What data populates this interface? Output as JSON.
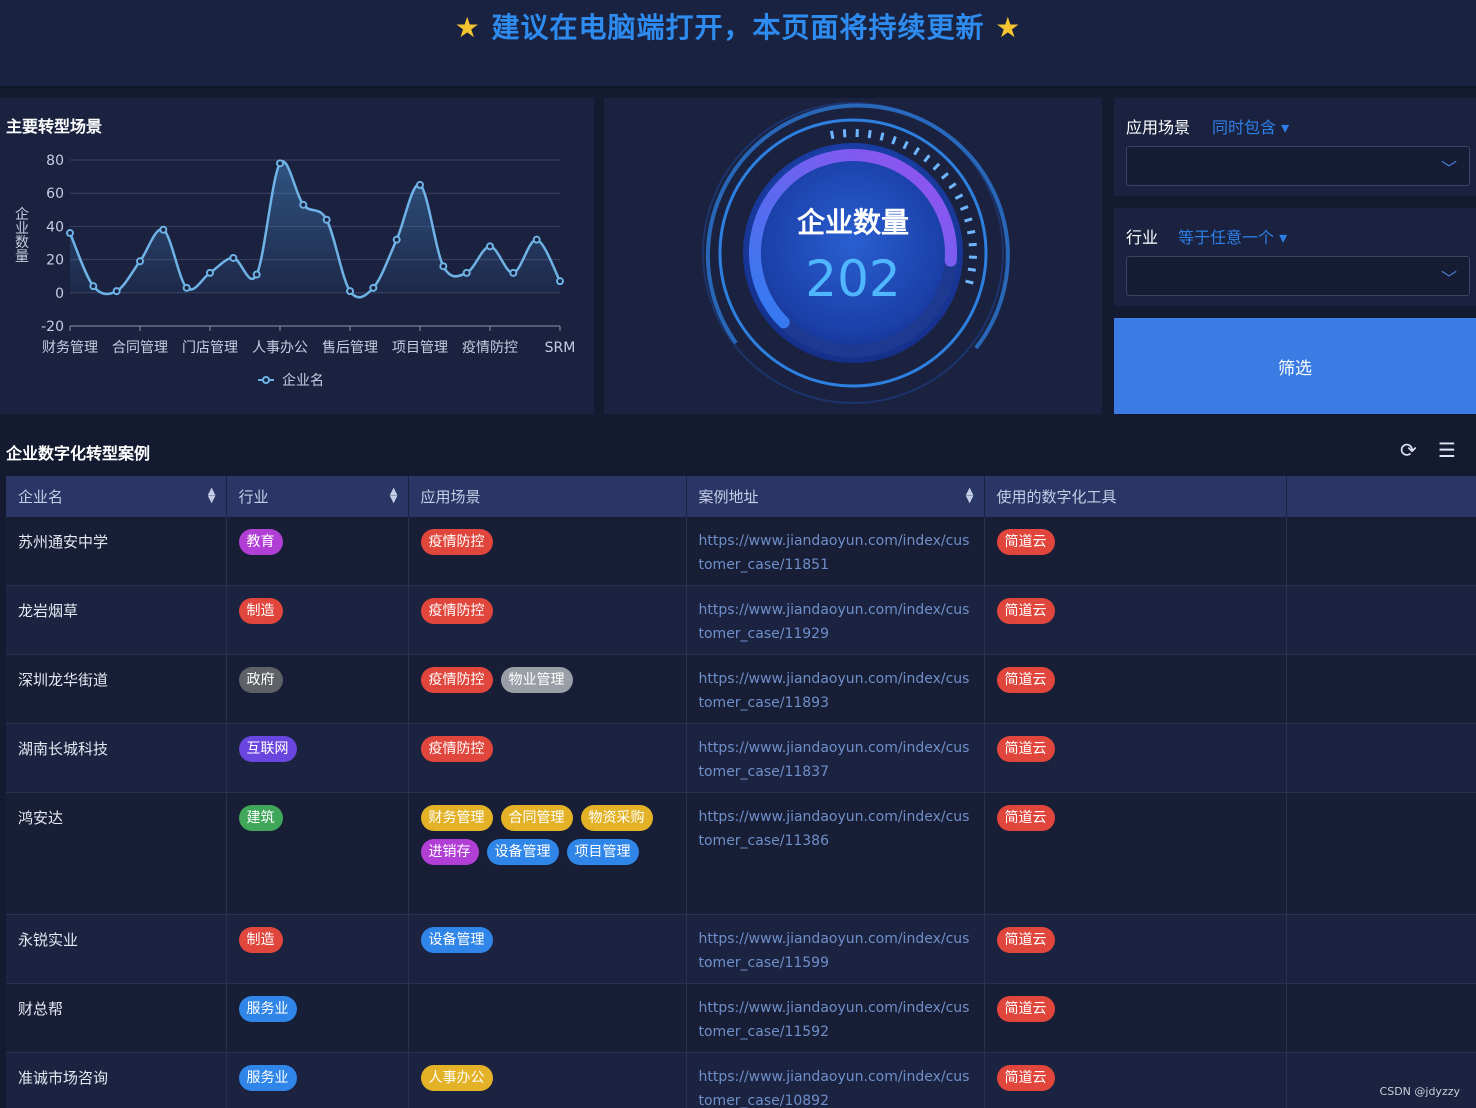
{
  "banner": {
    "star": "★",
    "text": "建议在电脑端打开，本页面将持续更新"
  },
  "chart_panel": {
    "title": "主要转型场景"
  },
  "chart_data": {
    "type": "line",
    "title": "主要转型场景",
    "ylabel": "企业数量",
    "xlabel": "",
    "ylim": [
      -20,
      80
    ],
    "yticks": [
      80,
      60,
      40,
      20,
      0,
      -20
    ],
    "tick_labels": [
      "财务管理",
      "合同管理",
      "门店管理",
      "人事办公",
      "售后管理",
      "项目管理",
      "疫情防控",
      "SRM"
    ],
    "grid": true,
    "legend_position": "bottom",
    "series": [
      {
        "name": "企业名",
        "color": "#6fb3e6",
        "values": [
          36,
          4,
          1,
          19,
          38,
          3,
          12,
          21,
          11,
          78,
          53,
          44,
          1,
          3,
          32,
          65,
          16,
          12,
          28,
          12,
          32,
          7
        ]
      }
    ]
  },
  "gauge": {
    "title": "企业数量",
    "value": "202",
    "fill_fraction": 0.85
  },
  "filters": [
    {
      "label": "应用场景",
      "mode": "同时包含",
      "value": ""
    },
    {
      "label": "行业",
      "mode": "等于任意一个",
      "value": ""
    }
  ],
  "filter_button": "筛选",
  "table": {
    "title": "企业数字化转型案例",
    "columns": [
      "企业名",
      "行业",
      "应用场景",
      "案例地址",
      "使用的数字化工具",
      ""
    ],
    "tag_colors": {
      "教育": "#b13fd6",
      "制造": "#e0463c",
      "政府": "#5e6166",
      "互联网": "#6a46e0",
      "建筑": "#3fa65a",
      "服务业": "#2f86e8",
      "疫情防控": "#e0463c",
      "物业管理": "#9a9ea6",
      "财务管理": "#e3b227",
      "合同管理": "#e3b227",
      "物资采购": "#e3b227",
      "进销存": "#b13fd6",
      "设备管理": "#2f86e8",
      "项目管理": "#2f86e8",
      "人事办公": "#e3b227",
      "简道云": "#e0463c"
    },
    "rows": [
      {
        "name": "苏州通安中学",
        "industry": [
          "教育"
        ],
        "scenes": [
          "疫情防控"
        ],
        "url": "https://www.jiandaoyun.com/index/customer_case/11851",
        "tools": [
          "简道云"
        ]
      },
      {
        "name": "龙岩烟草",
        "industry": [
          "制造"
        ],
        "scenes": [
          "疫情防控"
        ],
        "url": "https://www.jiandaoyun.com/index/customer_case/11929",
        "tools": [
          "简道云"
        ]
      },
      {
        "name": "深圳龙华街道",
        "industry": [
          "政府"
        ],
        "scenes": [
          "疫情防控",
          "物业管理"
        ],
        "url": "https://www.jiandaoyun.com/index/customer_case/11893",
        "tools": [
          "简道云"
        ]
      },
      {
        "name": "湖南长城科技",
        "industry": [
          "互联网"
        ],
        "scenes": [
          "疫情防控"
        ],
        "url": "https://www.jiandaoyun.com/index/customer_case/11837",
        "tools": [
          "简道云"
        ]
      },
      {
        "name": "鸿安达",
        "industry": [
          "建筑"
        ],
        "scenes": [
          "财务管理",
          "合同管理",
          "物资采购",
          "进销存",
          "设备管理",
          "项目管理"
        ],
        "url": "https://www.jiandaoyun.com/index/customer_case/11386",
        "tools": [
          "简道云"
        ]
      },
      {
        "name": "永锐实业",
        "industry": [
          "制造"
        ],
        "scenes": [
          "设备管理"
        ],
        "url": "https://www.jiandaoyun.com/index/customer_case/11599",
        "tools": [
          "简道云"
        ]
      },
      {
        "name": "财总帮",
        "industry": [
          "服务业"
        ],
        "scenes": [],
        "url": "https://www.jiandaoyun.com/index/customer_case/11592",
        "tools": [
          "简道云"
        ]
      },
      {
        "name": "准诚市场咨询",
        "industry": [
          "服务业"
        ],
        "scenes": [
          "人事办公"
        ],
        "url": "https://www.jiandaoyun.com/index/customer_case/10892",
        "tools": [
          "简道云"
        ]
      }
    ]
  },
  "icons": {
    "refresh": "refresh-icon",
    "column_settings": "column-settings-icon",
    "dropdown": "chevron-down-icon",
    "sort": "sort-icon"
  },
  "watermark": "CSDN @jdyzzy"
}
